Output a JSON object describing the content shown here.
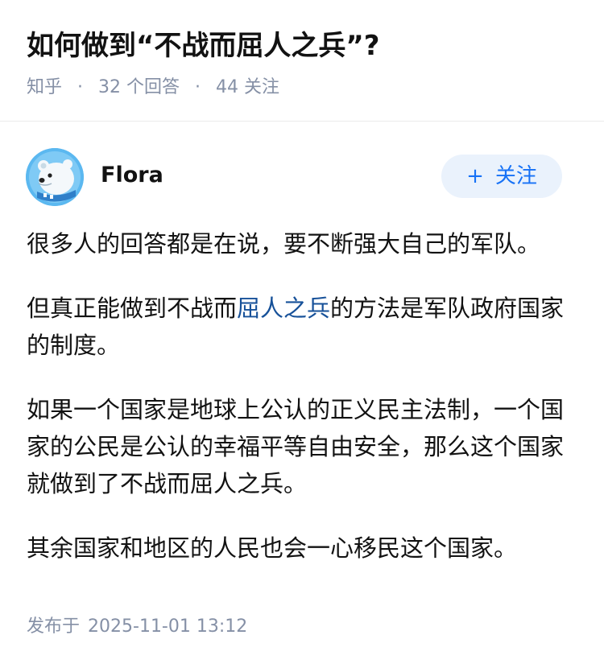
{
  "question": {
    "title": "如何做到“不战而屈人之兵”?",
    "source": "知乎",
    "separator": "·",
    "answers_count": "32 个回答",
    "followers_count": "44 关注"
  },
  "author": {
    "name": "Flora",
    "follow_plus": "+",
    "follow_label": "关注",
    "avatar_icon": "polar-bear-avatar-icon"
  },
  "answer": {
    "p1": "很多人的回答都是在说，要不断强大自己的军队。",
    "p2_before": "但真正能做到不战而",
    "p2_link": "屈人之兵",
    "p2_after": "的方法是军队政府国家的制度。",
    "p3": "如果一个国家是地球上公认的正义民主法制，一个国家的公民是公认的幸福平等自由安全，那么这个国家就做到了不战而屈人之兵。",
    "p4": "其余国家和地区的人民也会一心移民这个国家。"
  },
  "footer": {
    "publish_label": "发布于",
    "publish_time": "2025-11-01 13:12"
  },
  "colors": {
    "accent": "#1772f6",
    "link": "#175199",
    "meta": "#8590a6",
    "follow_bg": "#eaf2fc",
    "avatar_bg": "#5bb8f0"
  }
}
